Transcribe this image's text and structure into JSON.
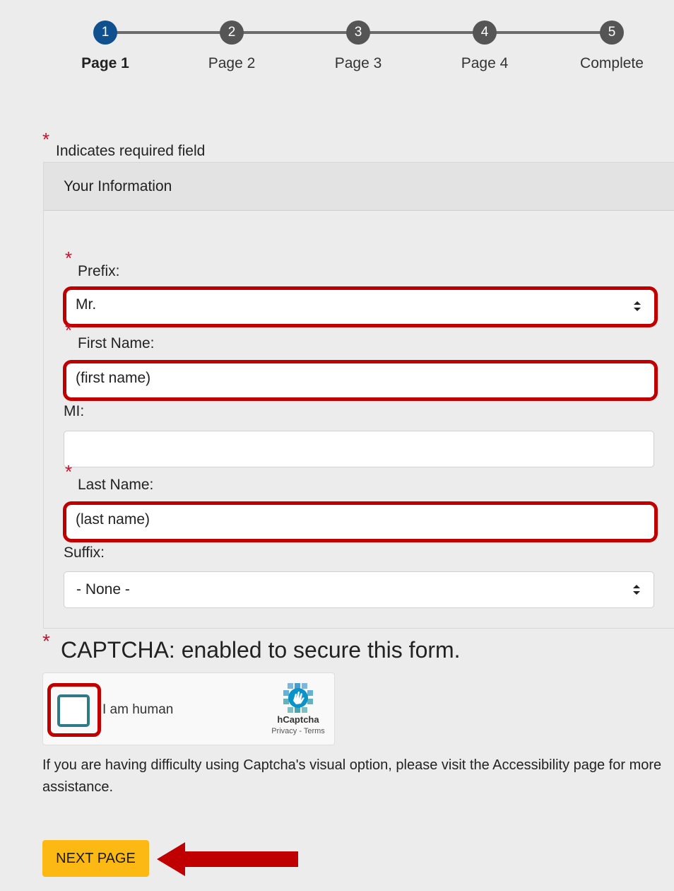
{
  "stepper": {
    "steps": [
      {
        "number": "1",
        "label": "Page 1",
        "active": true
      },
      {
        "number": "2",
        "label": "Page 2",
        "active": false
      },
      {
        "number": "3",
        "label": "Page 3",
        "active": false
      },
      {
        "number": "4",
        "label": "Page 4",
        "active": false
      },
      {
        "number": "5",
        "label": "Complete",
        "active": false
      }
    ],
    "active_color": "#10508f",
    "inactive_color": "#555555"
  },
  "required_note": {
    "asterisk": "*",
    "text": "Indicates required field"
  },
  "panel": {
    "title": "Your Information",
    "prefix": {
      "label": "Prefix:",
      "required": true,
      "value": "Mr.",
      "type": "select"
    },
    "first_name": {
      "label": "First Name:",
      "required": true,
      "value": "(first name)"
    },
    "mi": {
      "label": "MI:",
      "required": false,
      "value": ""
    },
    "last_name": {
      "label": "Last Name:",
      "required": true,
      "value": "(last name)"
    },
    "suffix": {
      "label": "Suffix:",
      "required": false,
      "value": "- None -",
      "type": "select"
    }
  },
  "captcha": {
    "heading": "CAPTCHA: enabled to secure this form.",
    "checkbox_label": "I am human",
    "brand": "hCaptcha",
    "links": "Privacy - Terms",
    "help_text": "If you are having difficulty using Captcha's visual option, please visit the Accessibility page for more assistance."
  },
  "actions": {
    "next_label": "NEXT PAGE",
    "button_color": "#fcb813"
  },
  "annotations": {
    "highlight_color": "#c00000"
  }
}
